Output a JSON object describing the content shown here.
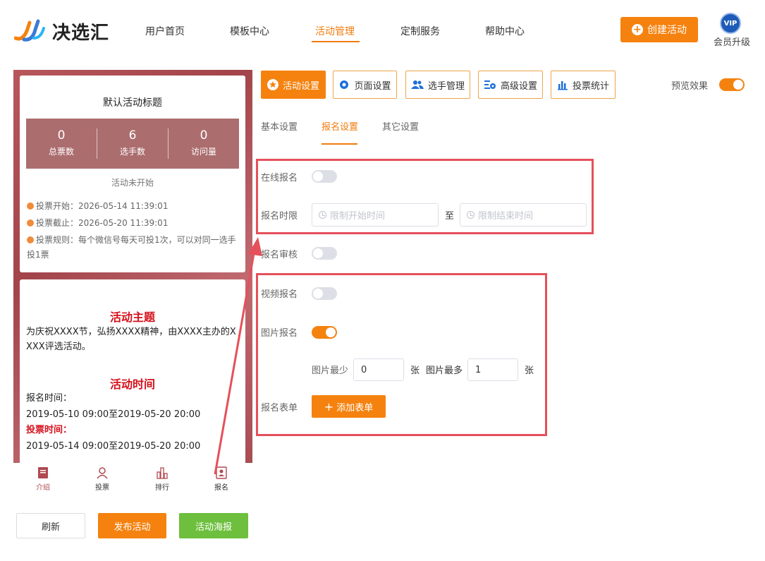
{
  "brand": {
    "name": "决选汇"
  },
  "nav": {
    "items": [
      "用户首页",
      "模板中心",
      "活动管理",
      "定制服务",
      "帮助中心"
    ],
    "active_index": 2
  },
  "header": {
    "create_label": "创建活动",
    "vip_badge": "VIP",
    "vip_label": "会员升级"
  },
  "preview": {
    "title": "默认活动标题",
    "stats": [
      {
        "value": "0",
        "label": "总票数"
      },
      {
        "value": "6",
        "label": "选手数"
      },
      {
        "value": "0",
        "label": "访问量"
      }
    ],
    "status": "活动未开始",
    "info": [
      "投票开始：2026-05-14 11:39:01",
      "投票截止：2026-05-20 11:39:01",
      "投票规则：每个微信号每天可投1次，可以对同一选手投1票"
    ],
    "theme_title": "活动主题",
    "theme_text": "为庆祝XXXX节，弘扬XXXX精神，由XXXX主办的XXXX评选活动。",
    "time_title": "活动时间",
    "signup_time_label": "报名时间：",
    "signup_time": "2019-05-10 09:00至2019-05-20 20:00",
    "vote_time_label": "投票时间：",
    "vote_time": "2019-05-14 09:00至2019-05-20 20:00",
    "tabs": [
      "介绍",
      "投票",
      "排行",
      "报名"
    ],
    "active_tab": 0
  },
  "actions": {
    "refresh": "刷新",
    "publish": "发布活动",
    "poster": "活动海报"
  },
  "settings": {
    "top_tabs": [
      "活动设置",
      "页面设置",
      "选手管理",
      "高级设置",
      "投票统计"
    ],
    "active_top_tab": 0,
    "preview_label": "预览效果",
    "preview_on": true,
    "sub_tabs": [
      "基本设置",
      "报名设置",
      "其它设置"
    ],
    "active_sub_tab": 1,
    "online_signup_label": "在线报名",
    "online_signup_on": false,
    "time_limit_label": "报名时限",
    "start_placeholder": "限制开始时间",
    "to_label": "至",
    "end_placeholder": "限制结束时间",
    "review_label": "报名审核",
    "review_on": false,
    "video_label": "视频报名",
    "video_on": false,
    "image_label": "图片报名",
    "image_on": true,
    "image_min_label": "图片最少",
    "image_min_value": "0",
    "unit": "张",
    "image_max_label": "图片最多",
    "image_max_value": "1",
    "form_label": "报名表单",
    "add_form_label": "添加表单"
  },
  "colors": {
    "accent": "#f5820f",
    "highlight_box": "#e5505a",
    "stats_bg": "#ac6d6f",
    "poster_green": "#6dbf3d"
  }
}
